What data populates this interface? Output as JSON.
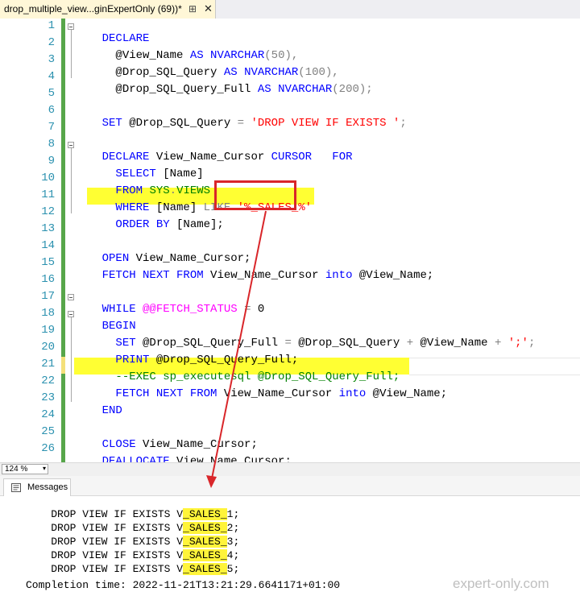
{
  "window": {
    "tab_title": "drop_multiple_view...ginExpertOnly (69))*",
    "tab_pin": "⊞",
    "tab_close": "✕"
  },
  "editor": {
    "line_numbers": [
      "1",
      "2",
      "3",
      "4",
      "5",
      "6",
      "7",
      "8",
      "9",
      "10",
      "11",
      "12",
      "13",
      "14",
      "15",
      "16",
      "17",
      "18",
      "19",
      "20",
      "21",
      "22",
      "23",
      "24",
      "25",
      "26"
    ],
    "lines": {
      "l1": [
        "DECLARE"
      ],
      "l2": [
        "  @View_Name ",
        "AS",
        " ",
        "NVARCHAR",
        "(50),"
      ],
      "l3": [
        "  @Drop_SQL_Query ",
        "AS",
        " ",
        "NVARCHAR",
        "(100),"
      ],
      "l4": [
        "  @Drop_SQL_Query_Full ",
        "AS",
        " ",
        "NVARCHAR",
        "(200);"
      ],
      "l6": [
        "SET",
        " @Drop_SQL_Query ",
        "=",
        " ",
        "'DROP VIEW IF EXISTS '",
        ";"
      ],
      "l8": [
        "DECLARE",
        " View_Name_Cursor ",
        "CURSOR",
        "   ",
        "FOR"
      ],
      "l9": [
        "  SELECT",
        " [Name]"
      ],
      "l10": [
        "  FROM",
        " ",
        "SYS",
        ".",
        "VIEWS"
      ],
      "l11": [
        "  WHERE",
        " [Name] ",
        "LIKE",
        " ",
        "'%_SALES_%'"
      ],
      "l12": [
        "  ORDER BY",
        " [Name];"
      ],
      "l14": [
        "OPEN",
        " View_Name_Cursor;"
      ],
      "l15": [
        "FETCH NEXT FROM",
        " View_Name_Cursor ",
        "into",
        " @View_Name;"
      ],
      "l17": [
        "WHILE",
        " ",
        "@@FETCH_STATUS",
        " ",
        "=",
        " 0"
      ],
      "l18": [
        "BEGIN"
      ],
      "l19": [
        "  SET",
        " @Drop_SQL_Query_Full ",
        "=",
        " @Drop_SQL_Query ",
        "+",
        " @View_Name ",
        "+",
        " ",
        "';'",
        ";"
      ],
      "l20": [
        "  PRINT",
        " @Drop_SQL_Query_Full;"
      ],
      "l21": [
        "  --EXEC sp_executesql @Drop_SQL_Query_Full;"
      ],
      "l22": [
        "  FETCH NEXT FROM",
        " View_Name_Cursor ",
        "into",
        " @View_Name;"
      ],
      "l23": [
        "END"
      ],
      "l25": [
        "CLOSE",
        " View_Name_Cursor;"
      ],
      "l26": [
        "DEALLOCATE",
        " View_Name_Cursor;"
      ]
    }
  },
  "status": {
    "zoom": "124 %",
    "zoom_arrow": "▾"
  },
  "results": {
    "tab_label": "Messages",
    "rows": [
      [
        "DROP VIEW IF EXISTS V",
        "_SALES_",
        "1;"
      ],
      [
        "DROP VIEW IF EXISTS V",
        "_SALES_",
        "2;"
      ],
      [
        "DROP VIEW IF EXISTS V",
        "_SALES_",
        "3;"
      ],
      [
        "DROP VIEW IF EXISTS V",
        "_SALES_",
        "4;"
      ],
      [
        "DROP VIEW IF EXISTS V",
        "_SALES_",
        "5;"
      ]
    ],
    "completion": "Completion time: 2022-11-21T13:21:29.6641171+01:00",
    "watermark": "expert-only.com"
  },
  "colors": {
    "keyword": "#0000ff",
    "system_function": "#ff00ff",
    "string": "#ff0000",
    "comment": "#008000",
    "line_number": "#2b91af",
    "highlight": "#ffff33",
    "annotation_red": "#d9262a"
  }
}
